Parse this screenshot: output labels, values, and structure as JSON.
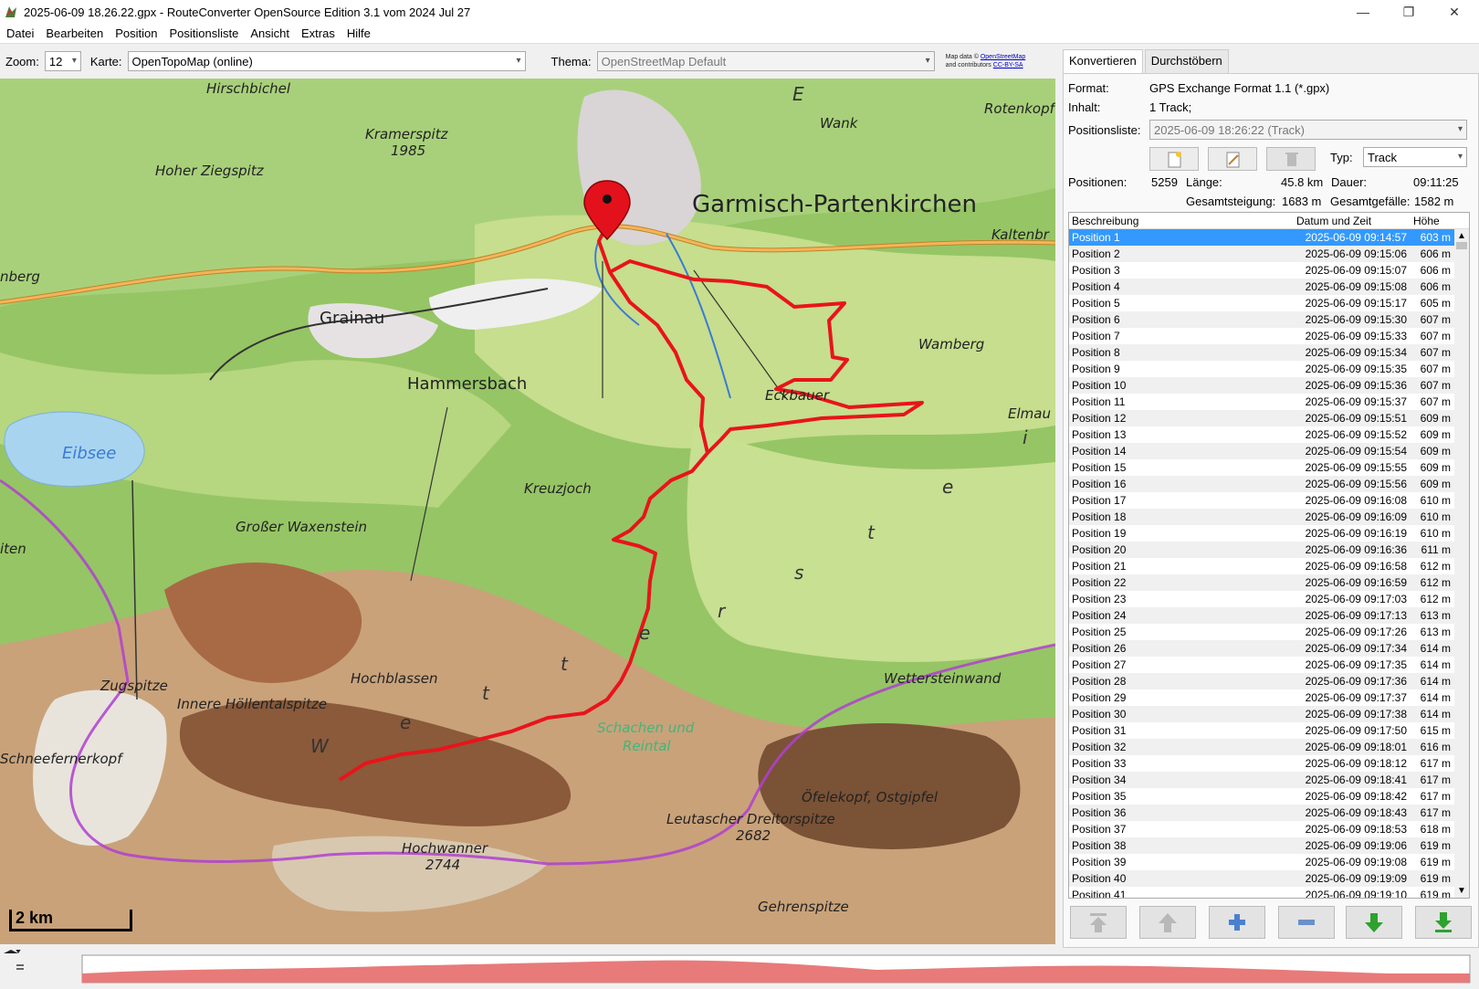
{
  "window": {
    "title": "2025-06-09 18.26.22.gpx - RouteConverter OpenSource Edition 3.1 vom 2024 Jul 27",
    "controls": [
      "—",
      "❐",
      "✕"
    ]
  },
  "menu": [
    "Datei",
    "Bearbeiten",
    "Position",
    "Positionsliste",
    "Ansicht",
    "Extras",
    "Hilfe"
  ],
  "toolbar": {
    "zoom_label": "Zoom:",
    "zoom_value": "12",
    "karte_label": "Karte:",
    "karte_value": "OpenTopoMap (online)",
    "thema_label": "Thema:",
    "thema_value": "OpenStreetMap Default",
    "attribution_line1": "Map data © ",
    "attribution_link1": "OpenStreetMap",
    "attribution_line2": "and contributors ",
    "attribution_link2": "CC-BY-SA"
  },
  "map": {
    "scale_label": "2 km",
    "labels": {
      "hirschbichel": "Hirschbichel",
      "kramerspitz": "Kramerspitz",
      "kramerspitz_ele": "1985",
      "hoher_ziegspitz": "Hoher Ziegspitz",
      "wank": "Wank",
      "rotenkopf": "Rotenkopf",
      "garmisch": "Garmisch-Partenkirchen",
      "kaltenbr": "Kaltenbr",
      "nberg": "nberg",
      "grainau": "Grainau",
      "hammersbach": "Hammersbach",
      "wamberg": "Wamberg",
      "eckbauer": "Eckbauer",
      "elmau": "Elmau",
      "eibsee": "Eibsee",
      "kreuzjoch": "Kreuzjoch",
      "waxenstein": "Großer Waxenstein",
      "iten": "iten",
      "zugspitze": "Zugspitze",
      "hochblassen": "Hochblassen",
      "hoellentalspitze": "Innere Höllentalspitze",
      "wettersteinwand": "Wettersteinwand",
      "schneefernerkopf": "Schneefernerkopf",
      "schachen": "Schachen und",
      "reintal": "Reintal",
      "ofelekopf": "Öfelekopf, Ostgipfel",
      "dreitorspitze": "Leutascher Dreitorspitze",
      "dreitorspitze_ele": "2682",
      "hochwanner": "Hochwanner",
      "hochwanner_ele": "2744",
      "gehrenspitze": "Gehrenspitze",
      "wetterstein_w": "W",
      "wetterstein_e1": "e",
      "wetterstein_t1": "t",
      "wetterstein_t2": "t",
      "wetterstein_e2": "e",
      "est_e": "e",
      "est_t": "t",
      "est_s": "s",
      "est_r": "r",
      "est_e3": "e",
      "e_top": "E",
      "i_mark": "i"
    }
  },
  "tabs": [
    "Konvertieren",
    "Durchstöbern"
  ],
  "info": {
    "format_label": "Format:",
    "format_value": "GPS Exchange Format 1.1 (*.gpx)",
    "inhalt_label": "Inhalt:",
    "inhalt_value": "1 Track;",
    "positionsliste_label": "Positionsliste:",
    "positionsliste_value": "2025-06-09 18:26:22 (Track)",
    "typ_label": "Typ:",
    "typ_value": "Track",
    "positionen_label": "Positionen:",
    "positionen_value": "5259",
    "laenge_label": "Länge:",
    "laenge_value": "45.8 km",
    "dauer_label": "Dauer:",
    "dauer_value": "09:11:25",
    "steigung_label": "Gesamtsteigung:",
    "steigung_value": "1683 m",
    "gefaelle_label": "Gesamtgefälle:",
    "gefaelle_value": "1582 m"
  },
  "table": {
    "headers": [
      "Beschreibung",
      "Datum und Zeit",
      "Höhe"
    ],
    "rows": [
      [
        "Position 1",
        "2025-06-09 09:14:57",
        "603 m"
      ],
      [
        "Position 2",
        "2025-06-09 09:15:06",
        "606 m"
      ],
      [
        "Position 3",
        "2025-06-09 09:15:07",
        "606 m"
      ],
      [
        "Position 4",
        "2025-06-09 09:15:08",
        "606 m"
      ],
      [
        "Position 5",
        "2025-06-09 09:15:17",
        "605 m"
      ],
      [
        "Position 6",
        "2025-06-09 09:15:30",
        "607 m"
      ],
      [
        "Position 7",
        "2025-06-09 09:15:33",
        "607 m"
      ],
      [
        "Position 8",
        "2025-06-09 09:15:34",
        "607 m"
      ],
      [
        "Position 9",
        "2025-06-09 09:15:35",
        "607 m"
      ],
      [
        "Position 10",
        "2025-06-09 09:15:36",
        "607 m"
      ],
      [
        "Position 11",
        "2025-06-09 09:15:37",
        "607 m"
      ],
      [
        "Position 12",
        "2025-06-09 09:15:51",
        "609 m"
      ],
      [
        "Position 13",
        "2025-06-09 09:15:52",
        "609 m"
      ],
      [
        "Position 14",
        "2025-06-09 09:15:54",
        "609 m"
      ],
      [
        "Position 15",
        "2025-06-09 09:15:55",
        "609 m"
      ],
      [
        "Position 16",
        "2025-06-09 09:15:56",
        "609 m"
      ],
      [
        "Position 17",
        "2025-06-09 09:16:08",
        "610 m"
      ],
      [
        "Position 18",
        "2025-06-09 09:16:09",
        "610 m"
      ],
      [
        "Position 19",
        "2025-06-09 09:16:19",
        "610 m"
      ],
      [
        "Position 20",
        "2025-06-09 09:16:36",
        "611 m"
      ],
      [
        "Position 21",
        "2025-06-09 09:16:58",
        "612 m"
      ],
      [
        "Position 22",
        "2025-06-09 09:16:59",
        "612 m"
      ],
      [
        "Position 23",
        "2025-06-09 09:17:03",
        "612 m"
      ],
      [
        "Position 24",
        "2025-06-09 09:17:13",
        "613 m"
      ],
      [
        "Position 25",
        "2025-06-09 09:17:26",
        "613 m"
      ],
      [
        "Position 26",
        "2025-06-09 09:17:34",
        "614 m"
      ],
      [
        "Position 27",
        "2025-06-09 09:17:35",
        "614 m"
      ],
      [
        "Position 28",
        "2025-06-09 09:17:36",
        "614 m"
      ],
      [
        "Position 29",
        "2025-06-09 09:17:37",
        "614 m"
      ],
      [
        "Position 30",
        "2025-06-09 09:17:38",
        "614 m"
      ],
      [
        "Position 31",
        "2025-06-09 09:17:50",
        "615 m"
      ],
      [
        "Position 32",
        "2025-06-09 09:18:01",
        "616 m"
      ],
      [
        "Position 33",
        "2025-06-09 09:18:12",
        "617 m"
      ],
      [
        "Position 34",
        "2025-06-09 09:18:41",
        "617 m"
      ],
      [
        "Position 35",
        "2025-06-09 09:18:42",
        "617 m"
      ],
      [
        "Position 36",
        "2025-06-09 09:18:43",
        "617 m"
      ],
      [
        "Position 37",
        "2025-06-09 09:18:53",
        "618 m"
      ],
      [
        "Position 38",
        "2025-06-09 09:19:06",
        "619 m"
      ],
      [
        "Position 39",
        "2025-06-09 09:19:08",
        "619 m"
      ],
      [
        "Position 40",
        "2025-06-09 09:19:09",
        "619 m"
      ],
      [
        "Position 41",
        "2025-06-09 09:19:10",
        "619 m"
      ]
    ]
  },
  "icons": {
    "new": "new-list-icon",
    "rename": "rename-list-icon",
    "delete": "delete-list-icon",
    "top": "move-to-top-icon",
    "up": "move-up-icon",
    "add": "add-position-icon",
    "remove": "remove-position-icon",
    "down": "move-down-icon",
    "bottom": "move-to-bottom-icon"
  },
  "colors": {
    "selection": "#3399ff",
    "track": "#ee1111",
    "forest": "#8fbe5a",
    "meadow": "#c9df8e",
    "rock": "#c98a5a",
    "border": "#b040d0",
    "profile": "#e77"
  }
}
